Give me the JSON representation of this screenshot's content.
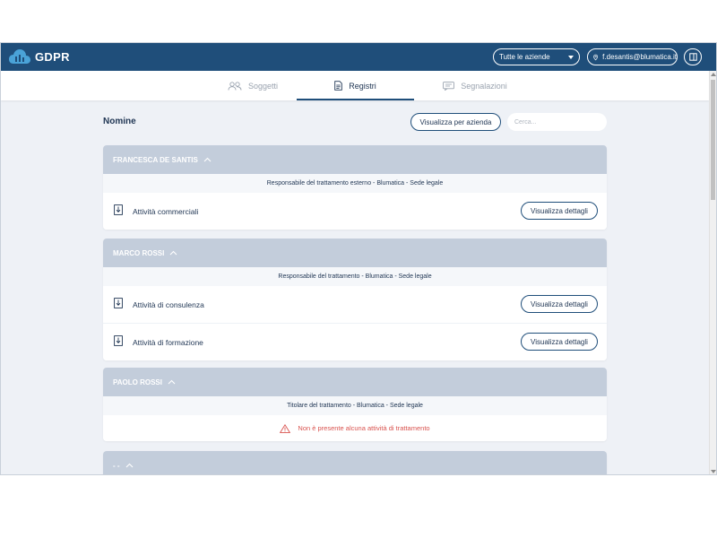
{
  "app": {
    "logo_text": "GDPR"
  },
  "header": {
    "company_select": "Tutte le aziende",
    "user_email": "f.desantis@blumatica.it"
  },
  "tabs": [
    {
      "label": "Soggetti",
      "icon": "users-icon",
      "active": false
    },
    {
      "label": "Registri",
      "icon": "document-icon",
      "active": true
    },
    {
      "label": "Segnalazioni",
      "icon": "message-icon",
      "active": false
    }
  ],
  "page": {
    "title": "Nomine",
    "view_by_company_label": "Visualizza per azienda",
    "search_placeholder": "Cerca..."
  },
  "cards": [
    {
      "name": "FRANCESCA DE SANTIS",
      "role": "Responsabile del trattamento esterno - Blumatica - Sede legale",
      "activities": [
        {
          "name": "Attività commerciali",
          "button": "Visualizza dettagli"
        }
      ]
    },
    {
      "name": "MARCO ROSSI",
      "role": "Responsabile del trattamento - Blumatica - Sede legale",
      "activities": [
        {
          "name": "Attività di consulenza",
          "button": "Visualizza dettagli"
        },
        {
          "name": "Attività di formazione",
          "button": "Visualizza dettagli"
        }
      ]
    },
    {
      "name": "PAOLO ROSSI",
      "role": "Titolare del trattamento - Blumatica - Sede legale",
      "empty_message": "Non è presente alcuna attività di trattamento"
    },
    {
      "name": "- -"
    }
  ],
  "colors": {
    "topbar": "#1f4e7a",
    "card_header": "#c3cddb",
    "background": "#eef1f6",
    "warning": "#d9534f"
  }
}
